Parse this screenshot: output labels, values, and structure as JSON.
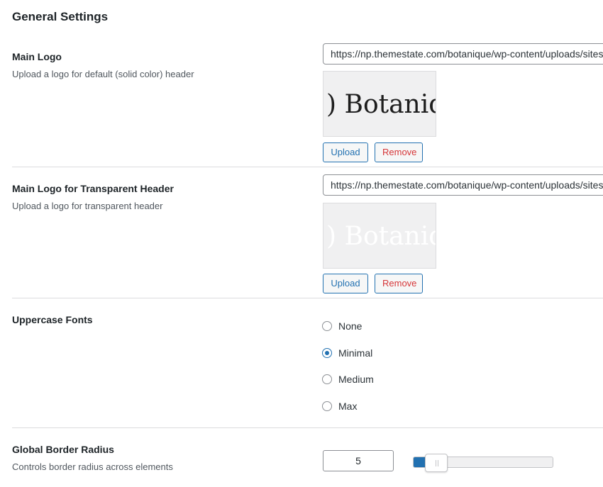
{
  "section": {
    "title": "General Settings"
  },
  "main_logo": {
    "label": "Main Logo",
    "description": "Upload a logo for default (solid color) header",
    "url": "https://np.themestate.com/botanique/wp-content/uploads/sites/",
    "preview_text": ") Botaniq",
    "preview_color": "#1d1d1d",
    "upload_label": "Upload",
    "remove_label": "Remove"
  },
  "transparent_logo": {
    "label": "Main Logo for Transparent Header",
    "description": "Upload a logo for transparent header",
    "url": "https://np.themestate.com/botanique/wp-content/uploads/sites/",
    "preview_text": ") Botaniq",
    "preview_color": "#ffffff",
    "upload_label": "Upload",
    "remove_label": "Remove"
  },
  "uppercase_fonts": {
    "label": "Uppercase Fonts",
    "options": [
      "None",
      "Minimal",
      "Medium",
      "Max"
    ],
    "selected": "Minimal"
  },
  "border_radius": {
    "label": "Global Border Radius",
    "description": "Controls border radius across elements",
    "value": "5",
    "slider_fraction": 0.1
  },
  "colors": {
    "accent": "#2271b1",
    "remove": "#d63638",
    "divider": "#dcdcde"
  }
}
